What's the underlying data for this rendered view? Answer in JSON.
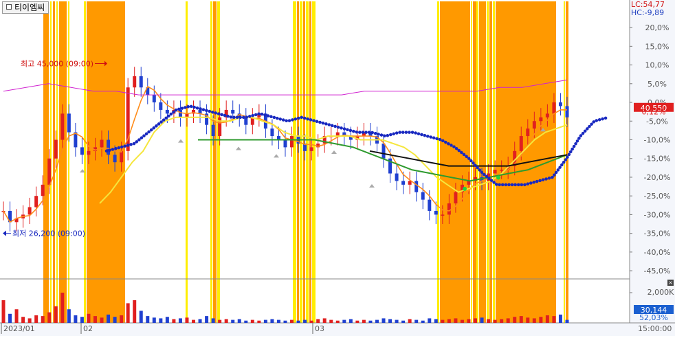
{
  "ticker": "티이엠씨",
  "header": {
    "lc_label": "LC:54,77",
    "hc_label": "HC:-9,89"
  },
  "annotations": {
    "high": "최고 45,000 (09:00)",
    "low": "최저 26,200 (09:00)"
  },
  "price_badge": "40,550",
  "change_badge": "0,12%",
  "volume_badge": "30,144",
  "volume_pct_badge": "52,03%",
  "volume_axis_label": "2,000K",
  "time_label": "15:00:00",
  "colors": {
    "up": "#e02020",
    "down": "#2040d0",
    "band_orange": "#ff9900",
    "band_yellow": "#ffee00",
    "ma_short": "#ff8c1a",
    "ma_mid": "#f5e63c",
    "ma_green": "#2e9a2e",
    "ma_black": "#111111",
    "ma_blue": "#1828c0"
  },
  "chart_data": {
    "type": "line",
    "title": "",
    "xlabel": "",
    "ylabel": "",
    "y_unit": "% from reference",
    "ylim": [
      -47,
      27
    ],
    "y_ticks": [
      "20,0%",
      "15,0%",
      "10,0%",
      "5,0%",
      "0,0%",
      "-5,0%",
      "-10,0%",
      "-15,0%",
      "-20,0%",
      "-25,0%",
      "-30,0%",
      "-35,0%",
      "-40,0%",
      "-45,0%"
    ],
    "x_tick_labels": [
      "2023/01",
      "02",
      "03"
    ],
    "grid": false,
    "series": [
      {
        "values": [
          -29,
          -32,
          -31,
          -30,
          -28,
          -25,
          -22,
          -15,
          -10,
          -3,
          -8,
          -12,
          -14,
          -13,
          -12,
          -10,
          -14,
          -16,
          -13,
          4,
          7,
          4,
          2,
          0,
          -2,
          -3,
          -2,
          -4,
          -3,
          -2,
          -3,
          -6,
          -9,
          -4,
          -2,
          -3,
          -4,
          -6,
          -4,
          -3,
          -7,
          -9,
          -10,
          -12,
          -9,
          -11,
          -13,
          -12,
          -11,
          -9,
          -9,
          -8,
          -9,
          -10,
          -9,
          -8,
          -9,
          -11,
          -15,
          -19,
          -21,
          -22,
          -21,
          -24,
          -26,
          -29,
          -30,
          -30,
          -27,
          -24,
          -22,
          -21,
          -20,
          -21,
          -19,
          -18,
          -18,
          -17,
          -13,
          -9,
          -7,
          -5,
          -4,
          -3,
          0,
          -1,
          -4
        ]
      },
      {
        "values": [
          -27,
          -24,
          -20,
          -16,
          -13,
          -8,
          -5,
          -4,
          -4,
          -4,
          -4,
          -5,
          -5,
          -4,
          -4,
          -5,
          -6,
          -8,
          -9,
          -9,
          -10,
          -9,
          -9,
          -9,
          -10,
          -10,
          -10,
          -11,
          -12,
          -14,
          -17,
          -20,
          -22,
          -24,
          -23,
          -22,
          -21,
          -19,
          -16,
          -13,
          -10,
          -8,
          -7,
          -6
        ]
      },
      {
        "values": [
          -10,
          -10,
          -10,
          -10,
          -10,
          -10,
          -10,
          -11,
          -12,
          -14,
          -16,
          -18,
          -19,
          -20,
          -21,
          -20,
          -19,
          -18,
          -16,
          -14
        ]
      },
      {
        "values": [
          -13,
          -14,
          -15,
          -16,
          -17,
          -17,
          -17,
          -17,
          -16,
          -15,
          -14
        ]
      },
      {
        "values": [
          -13,
          -12,
          -11,
          -8,
          -5,
          -2,
          -1,
          -2,
          -3,
          -4,
          -4,
          -3,
          -4,
          -5,
          -4,
          -5,
          -6,
          -7,
          -8,
          -8,
          -9,
          -8,
          -8,
          -9,
          -10,
          -12,
          -15,
          -19,
          -22,
          -22,
          -22,
          -21,
          -20,
          -15,
          -9,
          -5,
          -4
        ]
      }
    ]
  }
}
